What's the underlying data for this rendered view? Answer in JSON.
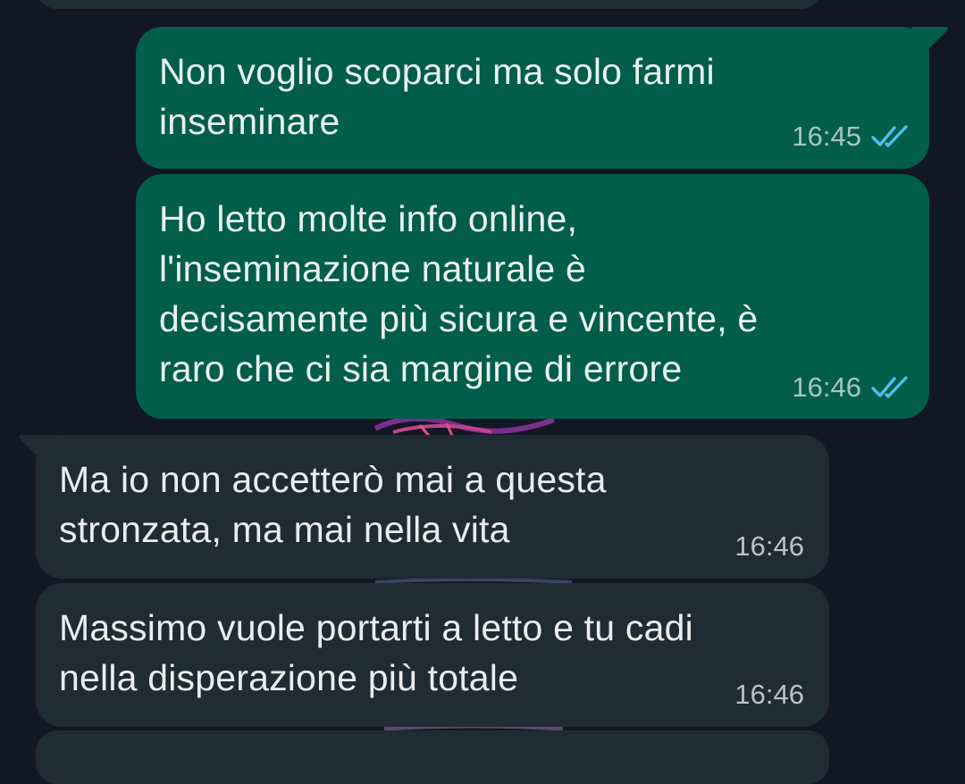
{
  "chat": {
    "messages": [
      {
        "direction": "outgoing",
        "lines": [
          "Non voglio scoparci ma solo farmi",
          "inseminare"
        ],
        "time": "16:45",
        "status_icon": "double-check-read-icon"
      },
      {
        "direction": "outgoing",
        "lines": [
          "Ho letto molte info online,",
          "l'inseminazione naturale è",
          "decisamente più sicura e vincente, è",
          "raro che ci sia margine di errore"
        ],
        "time": "16:46",
        "status_icon": "double-check-read-icon"
      },
      {
        "direction": "incoming",
        "lines": [
          "Ma io non accetterò mai a questa",
          "stronzata, ma mai nella vita"
        ],
        "time": "16:46"
      },
      {
        "direction": "incoming",
        "lines": [
          "Massimo vuole portarti a letto e tu cadi",
          "nella disperazione più totale"
        ],
        "time": "16:46"
      }
    ]
  },
  "colors": {
    "background": "#121726",
    "outgoing_bubble": "#025d4b",
    "incoming_bubble": "#1f2c34",
    "read_ticks": "#53bdeb"
  }
}
